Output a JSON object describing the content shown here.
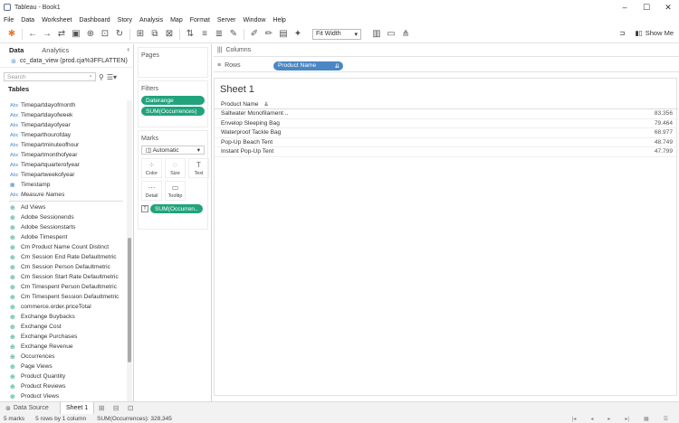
{
  "window": {
    "title": "Tableau - Book1"
  },
  "menu": [
    "File",
    "Data",
    "Worksheet",
    "Dashboard",
    "Story",
    "Analysis",
    "Map",
    "Format",
    "Server",
    "Window",
    "Help"
  ],
  "toolbar": {
    "fit_label": "Fit Width",
    "show_me_label": "Show Me"
  },
  "datapane": {
    "tabs": [
      "Data",
      "Analytics"
    ],
    "datasource_name": "cc_data_view (prod.cja%3FFLATTEN)",
    "search_placeholder": "Search",
    "tables_title": "Tables",
    "dimensions": [
      {
        "icon": "Abc",
        "name": "Timepartdayofmonth"
      },
      {
        "icon": "Abc",
        "name": "Timepartdayofweek"
      },
      {
        "icon": "Abc",
        "name": "Timepartdayofyear"
      },
      {
        "icon": "Abc",
        "name": "Timeparthourofday"
      },
      {
        "icon": "Abc",
        "name": "Timepartminuteofhour"
      },
      {
        "icon": "Abc",
        "name": "Timepartmonthofyear"
      },
      {
        "icon": "Abc",
        "name": "Timepartquarterofyear"
      },
      {
        "icon": "Abc",
        "name": "Timepartweekofyear"
      },
      {
        "icon": "▦",
        "name": "Timestamp"
      },
      {
        "icon": "Abc",
        "name": "Measure Names"
      }
    ],
    "measures": [
      "Ad Views",
      "Adobe Sessionends",
      "Adobe Sessionstarts",
      "Adobe Timespent",
      "Cm Product Name Count Distinct",
      "Cm Session End Rate Defaultmetric",
      "Cm Session Person Defaultmetric",
      "Cm Session Start Rate Defaultmetric",
      "Cm Timespent Person Defaultmetric",
      "Cm Timespent Session Defaultmetric",
      "commerce.order.priceTotal",
      "Exchange Buybacks",
      "Exchange Cost",
      "Exchange Purchases",
      "Exchange Revenue",
      "Occurrences",
      "Page Views",
      "Product Quantity",
      "Product Reviews",
      "Product Views"
    ]
  },
  "cards": {
    "pages_title": "Pages",
    "filters_title": "Filters",
    "filters": [
      "Daterange",
      "SUM(Occurrences)"
    ],
    "marks_title": "Marks",
    "marks_type": "Automatic",
    "marks_buttons": [
      {
        "icon": "⁘",
        "label": "Color"
      },
      {
        "icon": "◌",
        "label": "Size"
      },
      {
        "icon": "T",
        "label": "Text"
      },
      {
        "icon": "⋯",
        "label": "Detail"
      },
      {
        "icon": "▭",
        "label": "Tooltip"
      }
    ],
    "marks_pill": "SUM(Occurren.."
  },
  "shelves": {
    "columns_label": "Columns",
    "rows_label": "Rows",
    "rows_pill": "Product Name"
  },
  "sheet": {
    "title": "Sheet 1",
    "header": "Product Name",
    "rows": [
      {
        "name": "Saltwater Monofilament ..",
        "value": "83.356"
      },
      {
        "name": "Envelop Sleeping Bag",
        "value": "79.464"
      },
      {
        "name": "Waterproof Tackle Bag",
        "value": "68.977"
      },
      {
        "name": "Pop-Up Beach Tent",
        "value": "48.749"
      },
      {
        "name": "Instant Pop-Up Tent",
        "value": "47.799"
      }
    ]
  },
  "bottom": {
    "datasource_tab": "Data Source",
    "sheet_tab": "Sheet 1"
  },
  "status": {
    "marks": "5 marks",
    "rows_cols": "5 rows by 1 column",
    "sum": "SUM(Occurrences): 328,345"
  }
}
